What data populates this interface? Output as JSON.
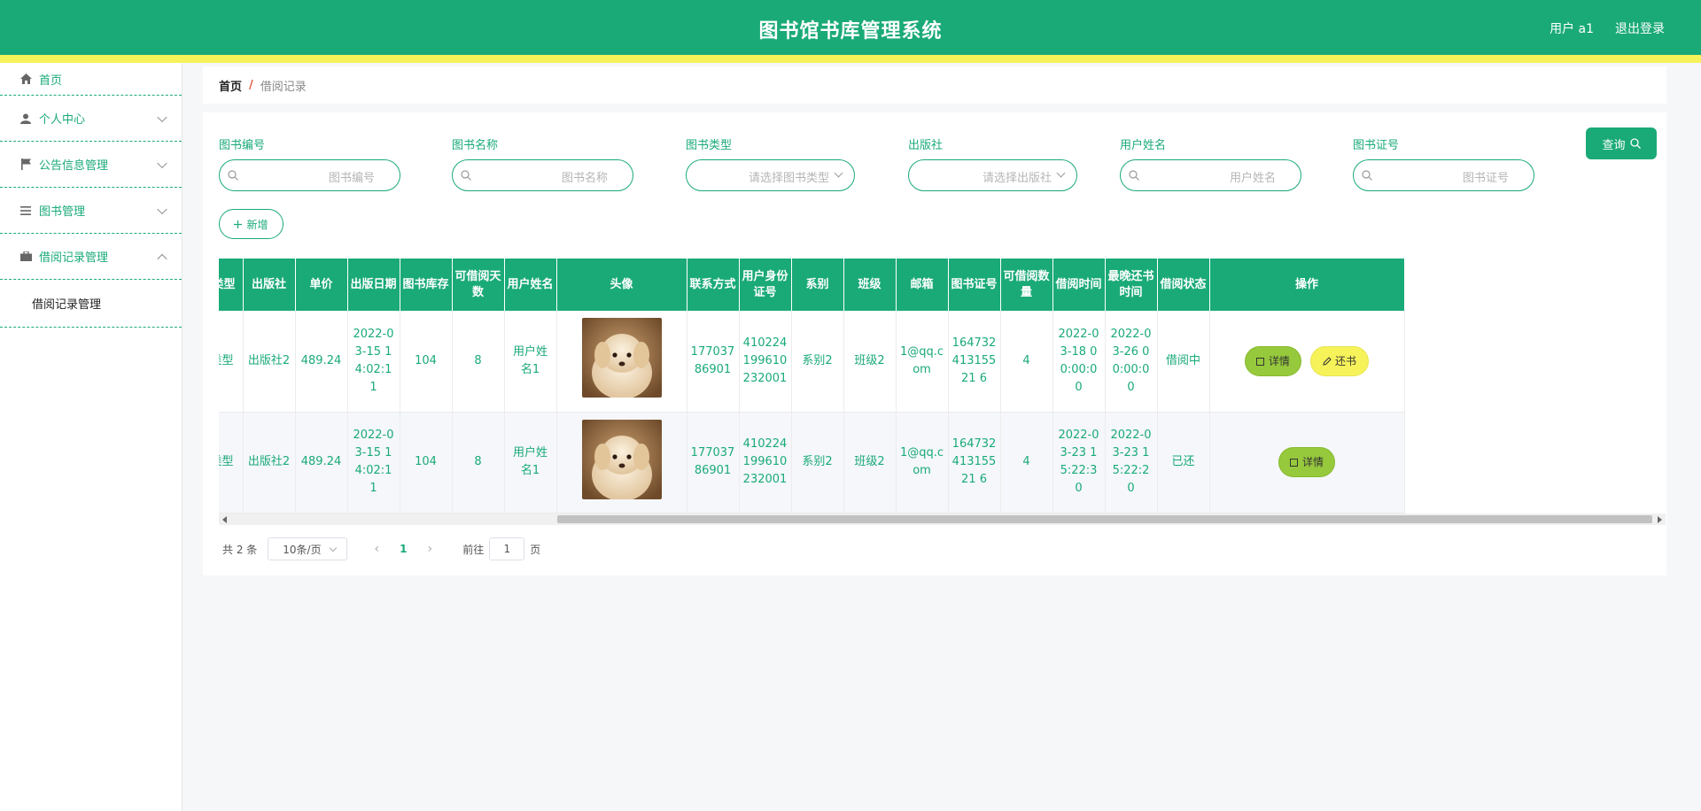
{
  "header": {
    "title": "图书馆书库管理系统",
    "user": "用户 a1",
    "logout": "退出登录"
  },
  "sidebar": {
    "items": [
      {
        "label": "首页",
        "icon": "home-icon"
      },
      {
        "label": "个人中心",
        "icon": "user-icon"
      },
      {
        "label": "公告信息管理",
        "icon": "flag-icon"
      },
      {
        "label": "图书管理",
        "icon": "list-icon"
      },
      {
        "label": "借阅记录管理",
        "icon": "briefcase-icon"
      }
    ],
    "submenu": "借阅记录管理"
  },
  "breadcrumb": {
    "home": "首页",
    "separator": "/",
    "current": "借阅记录"
  },
  "search": {
    "fields": [
      {
        "label": "图书编号",
        "placeholder": "图书编号"
      },
      {
        "label": "图书名称",
        "placeholder": "图书名称"
      },
      {
        "label": "图书类型",
        "placeholder": "请选择图书类型"
      },
      {
        "label": "出版社",
        "placeholder": "请选择出版社"
      },
      {
        "label": "用户姓名",
        "placeholder": "用户姓名"
      },
      {
        "label": "图书证号",
        "placeholder": "图书证号"
      }
    ],
    "query_button": "查询",
    "add_button": "新增"
  },
  "table": {
    "headers": [
      "类型",
      "出版社",
      "单价",
      "出版日期",
      "图书库存",
      "可借阅天数",
      "用户姓名",
      "头像",
      "联系方式",
      "用户身份证号",
      "系别",
      "班级",
      "邮箱",
      "图书证号",
      "可借阅数量",
      "借阅时间",
      "最晚还书时间",
      "借阅状态",
      "操作"
    ],
    "rows": [
      {
        "type": "类型",
        "publisher": "出版社2",
        "price": "489.24",
        "pub_date": "2022-03-15 14:02:11",
        "stock": "104",
        "days": "8",
        "user_name": "用户姓名1",
        "phone": "17703786901",
        "id_card": "410224199610232001",
        "dept": "系别2",
        "class": "班级2",
        "email": "1@qq.com",
        "card_no": "16473241315521 6",
        "quantity": "4",
        "borrow_time": "2022-03-18 00:00:00",
        "due_time": "2022-03-26 00:00:00",
        "status": "借阅中",
        "actions": [
          "详情",
          "还书"
        ]
      },
      {
        "type": "类型",
        "publisher": "出版社2",
        "price": "489.24",
        "pub_date": "2022-03-15 14:02:11",
        "stock": "104",
        "days": "8",
        "user_name": "用户姓名1",
        "phone": "17703786901",
        "id_card": "410224199610232001",
        "dept": "系别2",
        "class": "班级2",
        "email": "1@qq.com",
        "card_no": "16473241315521 6",
        "quantity": "4",
        "borrow_time": "2022-03-23 15:22:30",
        "due_time": "2022-03-23 15:22:20",
        "status": "已还",
        "actions": [
          "详情"
        ]
      }
    ]
  },
  "pagination": {
    "total": "共 2 条",
    "page_size": "10条/页",
    "current_page": "1",
    "goto_prefix": "前往",
    "goto_value": "1",
    "goto_suffix": "页"
  },
  "colors": {
    "primary": "#1aaa78",
    "accent_yellow": "#f6f25a",
    "detail_button": "#96c93c"
  }
}
